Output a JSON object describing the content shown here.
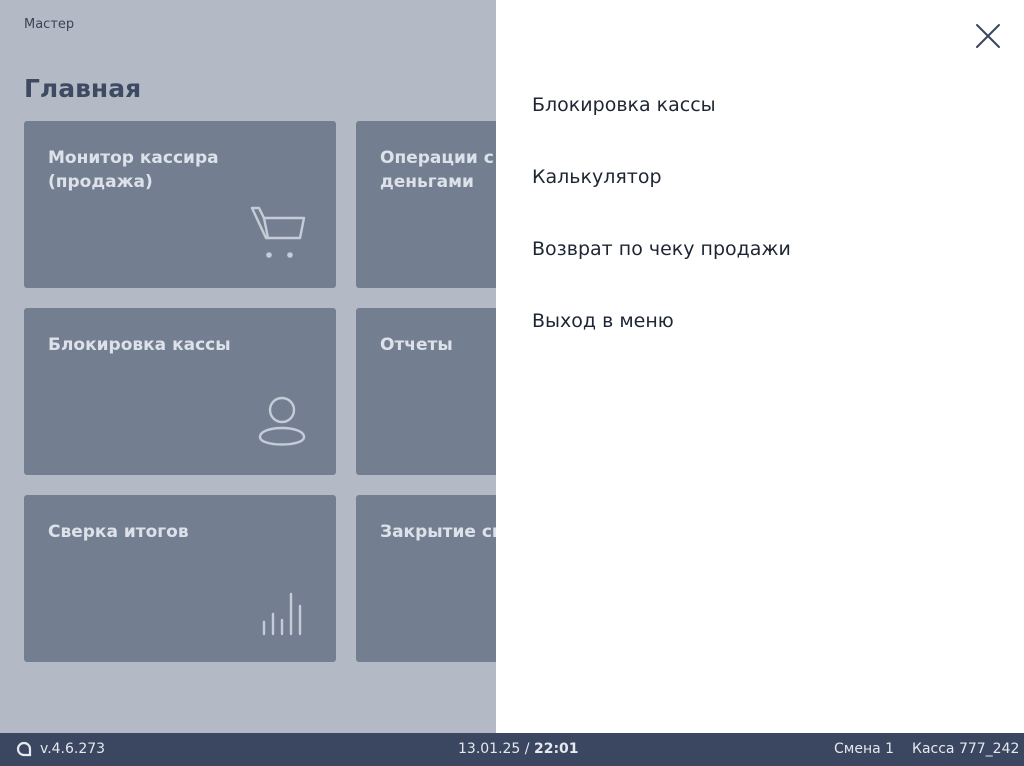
{
  "main": {
    "breadcrumb": "Мастер",
    "title": "Главная",
    "tiles": [
      {
        "label": "Монитор кассира\n(продажа)",
        "icon": "cart-icon"
      },
      {
        "label": "Операции с\nденьгами",
        "icon": ""
      },
      {
        "label": "Блокировка кассы",
        "icon": "user-icon"
      },
      {
        "label": "Отчеты",
        "icon": ""
      },
      {
        "label": "Сверка итогов",
        "icon": "bars-icon"
      },
      {
        "label": "Закрытие смены",
        "icon": ""
      }
    ]
  },
  "drawer": {
    "close_icon": "close-icon",
    "items": [
      {
        "label": "Блокировка кассы"
      },
      {
        "label": "Калькулятор"
      },
      {
        "label": "Возврат по чеку продажи"
      },
      {
        "label": "Выход в меню"
      }
    ]
  },
  "status_bar": {
    "version": "v.4.6.273",
    "date": "13.01.25",
    "separator": " / ",
    "time": "22:01",
    "shift": "Смена 1",
    "register": "Касса 777_242"
  },
  "colors": {
    "overlay": "#b3bac6",
    "tile": "#737f91",
    "status_bar": "#3b4660"
  }
}
